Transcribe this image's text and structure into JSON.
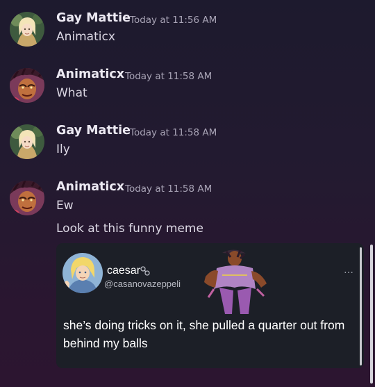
{
  "messages": [
    {
      "author": "Gay Mattie",
      "timestamp": "Today at 11:56 AM",
      "lines": [
        "Animaticx"
      ]
    },
    {
      "author": "Animaticx",
      "timestamp": "Today at 11:58 AM",
      "lines": [
        "What"
      ]
    },
    {
      "author": "Gay Mattie",
      "timestamp": "Today at 11:58 AM",
      "lines": [
        "Ily"
      ]
    },
    {
      "author": "Animaticx",
      "timestamp": "Today at 11:58 AM",
      "lines": [
        "Ew",
        "Look at this funny meme"
      ]
    }
  ],
  "embed": {
    "display_name": "caesar",
    "handle": "@casanovazeppeli",
    "text": "she’s doing tricks on it, she pulled a quarter out from behind my balls",
    "more_icon": "…",
    "verified_icon": "link-icon"
  },
  "colors": {
    "background_top": "#1d1a2e",
    "background_bottom": "#2c1530",
    "embed_bg": "#1c1f27",
    "username": "#ece9f2",
    "timestamp": "#a9a4b6"
  }
}
